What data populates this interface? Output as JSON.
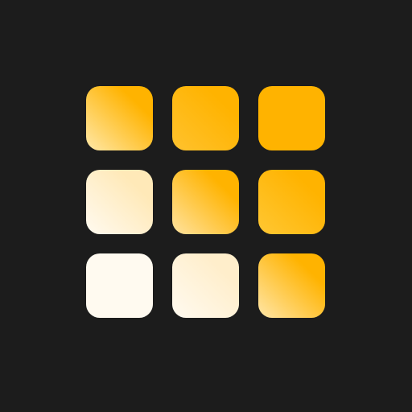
{
  "icon": {
    "background_color": "#1c1c1c",
    "palette": {
      "amber": "#ffb300",
      "cream": "#fffaf0"
    },
    "tiles": [
      {
        "row": 1,
        "col": 1,
        "style": "gradient",
        "from": "#ffb300",
        "to": "#ffe8a8"
      },
      {
        "row": 1,
        "col": 2,
        "style": "gradient",
        "from": "#ffb300",
        "to": "#ffc22e"
      },
      {
        "row": 1,
        "col": 3,
        "style": "solid",
        "from": "#ffb300",
        "to": "#ffb300"
      },
      {
        "row": 2,
        "col": 1,
        "style": "gradient",
        "from": "#ffe9b8",
        "to": "#fffaf0"
      },
      {
        "row": 2,
        "col": 2,
        "style": "gradient",
        "from": "#ffb300",
        "to": "#ffe3a0"
      },
      {
        "row": 2,
        "col": 3,
        "style": "gradient",
        "from": "#ffb300",
        "to": "#ffc733"
      },
      {
        "row": 3,
        "col": 1,
        "style": "solid",
        "from": "#fffaf0",
        "to": "#fffaf0"
      },
      {
        "row": 3,
        "col": 2,
        "style": "gradient",
        "from": "#ffeecb",
        "to": "#fffaf0"
      },
      {
        "row": 3,
        "col": 3,
        "style": "gradient",
        "from": "#ffb300",
        "to": "#ffe6a8"
      }
    ]
  }
}
